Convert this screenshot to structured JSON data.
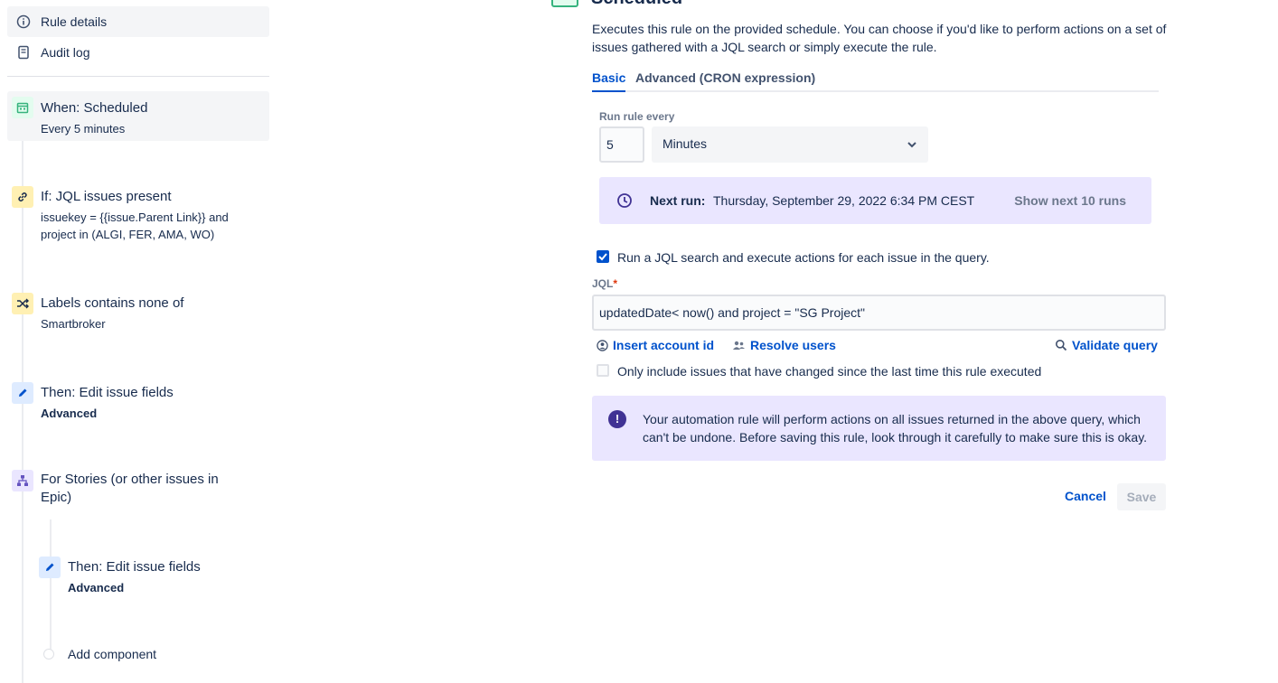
{
  "sidebar": {
    "nav": [
      {
        "label": "Rule details",
        "icon": "info-icon"
      },
      {
        "label": "Audit log",
        "icon": "document-icon"
      }
    ],
    "components": [
      {
        "title": "When: Scheduled",
        "sub": "Every 5 minutes",
        "icon": "calendar-icon",
        "color": "#36b37e"
      },
      {
        "title": "If: JQL issues present",
        "sub": "issuekey = {{issue.Parent Link}} and project in (ALGI, FER, AMA, WO)",
        "icon": "link-icon",
        "color": "#ffab00"
      },
      {
        "title": "Labels contains none of",
        "sub": "Smartbroker",
        "icon": "shuffle-icon",
        "color": "#ffab00"
      },
      {
        "title": "Then: Edit issue fields",
        "sub": "Advanced",
        "icon": "pencil-icon",
        "color": "#0052cc"
      },
      {
        "title": "For Stories (or other issues in Epic)",
        "icon": "hierarchy-icon",
        "color": "#6554c0"
      },
      {
        "title": "Then: Edit issue fields",
        "sub": "Advanced",
        "icon": "pencil-icon",
        "color": "#0052cc"
      }
    ],
    "add_component": "Add component"
  },
  "panel": {
    "title": "Scheduled",
    "description": "Executes this rule on the provided schedule. You can choose if you'd like to perform actions on a set of issues gathered with a JQL search or simply execute the rule.",
    "tabs": [
      "Basic",
      "Advanced (CRON expression)"
    ],
    "run_every_label": "Run rule every",
    "run_every_value": "5",
    "unit": "Minutes",
    "next_run_label": "Next run:",
    "next_run_value": "Thursday, September 29, 2022 6:34 PM CEST",
    "show_next": "Show next 10 runs",
    "jql_checkbox": "Run a JQL search and execute actions for each issue in the query.",
    "jql_label": "JQL",
    "jql_required": "*",
    "jql_value": "updatedDate< now() and project = \"SG Project\"",
    "insert_account": "Insert account id",
    "resolve_users": "Resolve users",
    "validate_query": "Validate query",
    "only_include": "Only include issues that have changed since the last time this rule executed",
    "warning": "Your automation rule will perform actions on all issues returned in the above query, which can't be undone. Before saving this rule, look through it carefully to make sure this is okay.",
    "warning_icon": "!",
    "cancel": "Cancel",
    "save": "Save"
  },
  "colors": {
    "brand": "#0052cc",
    "next_run_bg": "#eae6ff",
    "warning_icon": "#403294"
  }
}
